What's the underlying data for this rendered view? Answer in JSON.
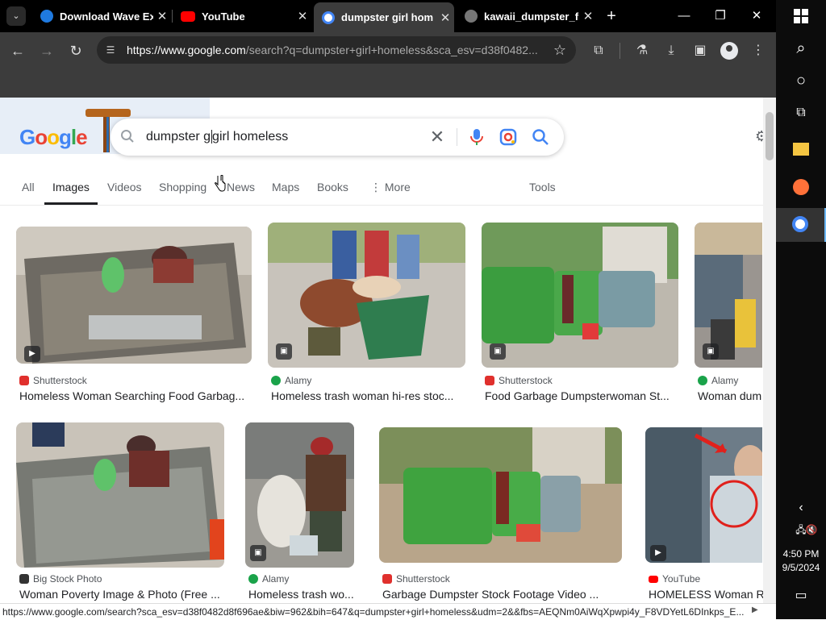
{
  "browser": {
    "tabs": [
      {
        "title": "Download Wave Ex",
        "favicon": "wave-icon",
        "active": false
      },
      {
        "title": "YouTube",
        "favicon": "youtube-icon",
        "active": false
      },
      {
        "title": "dumpster girl hom",
        "favicon": "google-icon",
        "active": true
      },
      {
        "title": "kawaii_dumpster_fi",
        "favicon": "globe-icon",
        "active": false
      }
    ],
    "url_host": "https://www.google.com",
    "url_path": "/search?q=dumpster+girl+homeless&sca_esv=d38f0482..."
  },
  "search": {
    "query_before_caret": "dumpster g",
    "query_after_caret": "girl homeless"
  },
  "search_tabs": [
    "All",
    "Images",
    "Videos",
    "Shopping",
    "News",
    "Maps",
    "Books",
    "More",
    "Tools"
  ],
  "results_row1": [
    {
      "source": "Shutterstock",
      "title": "Homeless Woman Searching Food Garbag...",
      "source_color": "#e0302d",
      "overlay": "video-play-icon"
    },
    {
      "source": "Alamy",
      "title": "Homeless trash woman hi-res stoc...",
      "source_color": "#1aa34a",
      "overlay": "image-icon"
    },
    {
      "source": "Shutterstock",
      "title": "Food Garbage Dumpsterwoman St...",
      "source_color": "#e0302d",
      "overlay": "image-icon"
    },
    {
      "source": "Alamy",
      "title": "Woman dum",
      "source_color": "#1aa34a",
      "overlay": "image-icon"
    }
  ],
  "results_row2": [
    {
      "source": "Big Stock Photo",
      "title": "Woman Poverty Image & Photo (Free ...",
      "source_color": "#333333",
      "overlay": ""
    },
    {
      "source": "Alamy",
      "title": "Homeless trash wo...",
      "source_color": "#1aa34a",
      "overlay": "image-icon"
    },
    {
      "source": "Shutterstock",
      "title": "Garbage Dumpster Stock Footage Video ...",
      "source_color": "#e0302d",
      "overlay": ""
    },
    {
      "source": "YouTube",
      "title": "HOMELESS Woman RE",
      "source_color": "#ff0000",
      "overlay": "video-play-icon"
    }
  ],
  "status_url": "https://www.google.com/search?sca_esv=d38f0482d8f696ae&biw=962&bih=647&q=dumpster+girl+homeless&udm=2&&fbs=AEQNm0AiWqXpwpi4y_F8VDYetL6DInkps_E...",
  "taskbar": {
    "time": "4:50 PM",
    "date": "9/5/2024"
  },
  "colors": {
    "chrome_dark": "#000000",
    "toolbar": "#3c3c3c",
    "google_blue": "#4285f4",
    "taskbar_accent": "#6cb8f6"
  }
}
